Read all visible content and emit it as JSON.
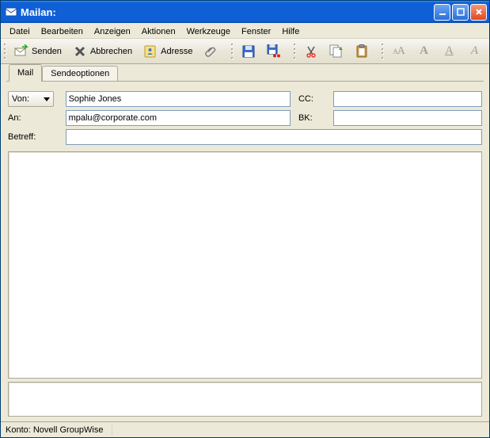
{
  "title": "Mailan:",
  "menu": {
    "datei": "Datei",
    "bearbeiten": "Bearbeiten",
    "anzeigen": "Anzeigen",
    "aktionen": "Aktionen",
    "werkzeuge": "Werkzeuge",
    "fenster": "Fenster",
    "hilfe": "Hilfe"
  },
  "toolbar": {
    "senden": "Senden",
    "abbrechen": "Abbrechen",
    "adresse": "Adresse"
  },
  "tabs": {
    "mail": "Mail",
    "sendeoptionen": "Sendeoptionen"
  },
  "form": {
    "von_label": "Von:",
    "von_value": "Sophie Jones",
    "an_label": "An:",
    "an_value": "mpalu@corporate.com",
    "cc_label": "CC:",
    "cc_value": "",
    "bk_label": "BK:",
    "bk_value": "",
    "betreff_label": "Betreff:",
    "betreff_value": ""
  },
  "status": {
    "konto": "Konto: Novell GroupWise"
  }
}
